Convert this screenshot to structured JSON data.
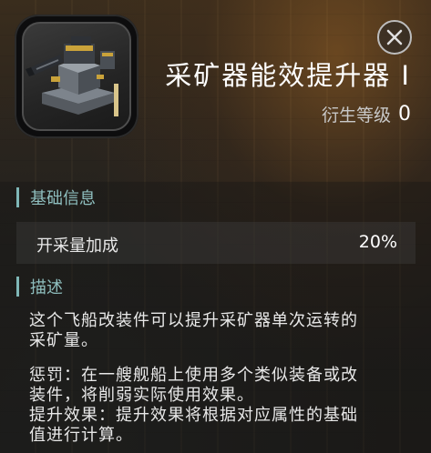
{
  "item": {
    "title": "采矿器能效提升器 I",
    "meta_label": "衍生等级",
    "meta_value": "0",
    "icon": "mining-upgrade-module-icon"
  },
  "close_icon": "close-icon",
  "sections": {
    "basic_info": {
      "header": "基础信息",
      "stat_name": "开采量加成",
      "stat_value": "20%"
    },
    "description": {
      "header": "描述",
      "line1": "这个飞船改装件可以提升采矿器单次运转的",
      "line2": "采矿量。",
      "line3": "惩罚：在一艘舰船上使用多个类似装备或改",
      "line4": "装件，将削弱实际使用效果。",
      "line5": "提升效果：提升效果将根据对应属性的基础",
      "line6": "值进行计算。"
    }
  },
  "colors": {
    "accent": "#7fb7b7",
    "tier_bar": "#d9c58a"
  }
}
